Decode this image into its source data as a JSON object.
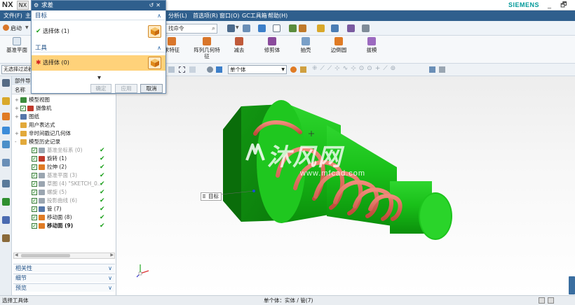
{
  "app": {
    "logo": "NX",
    "tab_label": "NX",
    "brand": "SIEMENS",
    "window_controls": "_ 🗗 ✕"
  },
  "menubar": {
    "items": [
      "文件(F)",
      "主页",
      "分析(L)",
      "首选项(R)",
      "窗口(O)",
      "GC工具箱",
      "帮助(H)"
    ]
  },
  "cmdbar": {
    "start_label": "启动",
    "search_placeholder": "找命令"
  },
  "ribbon": {
    "buttons": [
      "基准平面",
      "求特征",
      "阵列几何特征",
      "减去",
      "修剪体",
      "抽壳",
      "边倒圆",
      "拔模"
    ]
  },
  "selbar": {
    "filter_value": "无选择过滤器",
    "body_select_value": "单个体"
  },
  "dialog": {
    "title": "求差",
    "sections": [
      {
        "label": "目标",
        "row_label": "选择体 (1)",
        "state": "ok"
      },
      {
        "label": "工具",
        "row_label": "选择体 (0)",
        "state": "required"
      }
    ],
    "buttons": {
      "ok": "确定",
      "apply": "应用",
      "cancel": "取消"
    }
  },
  "navigator": {
    "title": "部件导航器",
    "column_header": "名称",
    "rows": [
      {
        "label": "模型视图",
        "indent": 0,
        "expand": "+",
        "style": "normal",
        "ok": false,
        "icon_color": "#3c8c3c",
        "check": false
      },
      {
        "label": "摄像机",
        "indent": 0,
        "expand": "+",
        "style": "normal",
        "ok": false,
        "icon_color": "#c0392b",
        "check": true
      },
      {
        "label": "图纸",
        "indent": 0,
        "expand": "+",
        "style": "normal",
        "ok": false,
        "icon_color": "#5577aa",
        "check": false
      },
      {
        "label": "用户表达式",
        "indent": 0,
        "expand": "",
        "style": "normal",
        "ok": false,
        "icon_color": "#e2a93b",
        "check": false
      },
      {
        "label": "非时间戳记几何体",
        "indent": 0,
        "expand": "+",
        "style": "normal",
        "ok": false,
        "icon_color": "#e2a93b",
        "check": false
      },
      {
        "label": "模型历史记录",
        "indent": 0,
        "expand": "-",
        "style": "normal",
        "ok": false,
        "icon_color": "#e2a93b",
        "check": false
      },
      {
        "label": "基准坐标系 (0)",
        "indent": 1,
        "expand": "",
        "style": "gray",
        "ok": true,
        "icon_color": "#9aa5b0",
        "check": true
      },
      {
        "label": "旋转 (1)",
        "indent": 1,
        "expand": "",
        "style": "normal",
        "ok": true,
        "icon_color": "#c0392b",
        "check": true
      },
      {
        "label": "拉伸 (2)",
        "indent": 1,
        "expand": "",
        "style": "normal",
        "ok": true,
        "icon_color": "#e07b24",
        "check": true
      },
      {
        "label": "基准平面 (3)",
        "indent": 1,
        "expand": "",
        "style": "gray",
        "ok": true,
        "icon_color": "#9aa5b0",
        "check": true
      },
      {
        "label": "草图 (4) \"SKETCH_0...",
        "indent": 1,
        "expand": "",
        "style": "gray",
        "ok": true,
        "icon_color": "#9aa5b0",
        "check": true
      },
      {
        "label": "螺旋 (5)",
        "indent": 1,
        "expand": "",
        "style": "gray",
        "ok": true,
        "icon_color": "#9aa5b0",
        "check": true
      },
      {
        "label": "投影曲线 (6)",
        "indent": 1,
        "expand": "",
        "style": "gray",
        "ok": true,
        "icon_color": "#9aa5b0",
        "check": true
      },
      {
        "label": "管 (7)",
        "indent": 1,
        "expand": "",
        "style": "normal",
        "ok": true,
        "icon_color": "#5577aa",
        "check": true
      },
      {
        "label": "移动面 (8)",
        "indent": 1,
        "expand": "",
        "style": "normal",
        "ok": true,
        "icon_color": "#e07b24",
        "check": true
      },
      {
        "label": "移动面 (9)",
        "indent": 1,
        "expand": "",
        "style": "bold",
        "ok": true,
        "icon_color": "#e07b24",
        "check": true
      }
    ],
    "panels": [
      "相关性",
      "细节",
      "预览"
    ]
  },
  "viewport": {
    "label": "目标",
    "watermark_main": "沐风网",
    "watermark_url": "www.mfcad.com"
  },
  "status": {
    "left": "选择工具体",
    "middle": "单个体：实体 / 管(7)"
  },
  "colors": {
    "menubar_bg": "#2f5f8d",
    "body_green": "#19c019",
    "coil_red": "#e06a5a",
    "check_green": "#1aa01a",
    "highlight_row": "#ffd27a"
  }
}
